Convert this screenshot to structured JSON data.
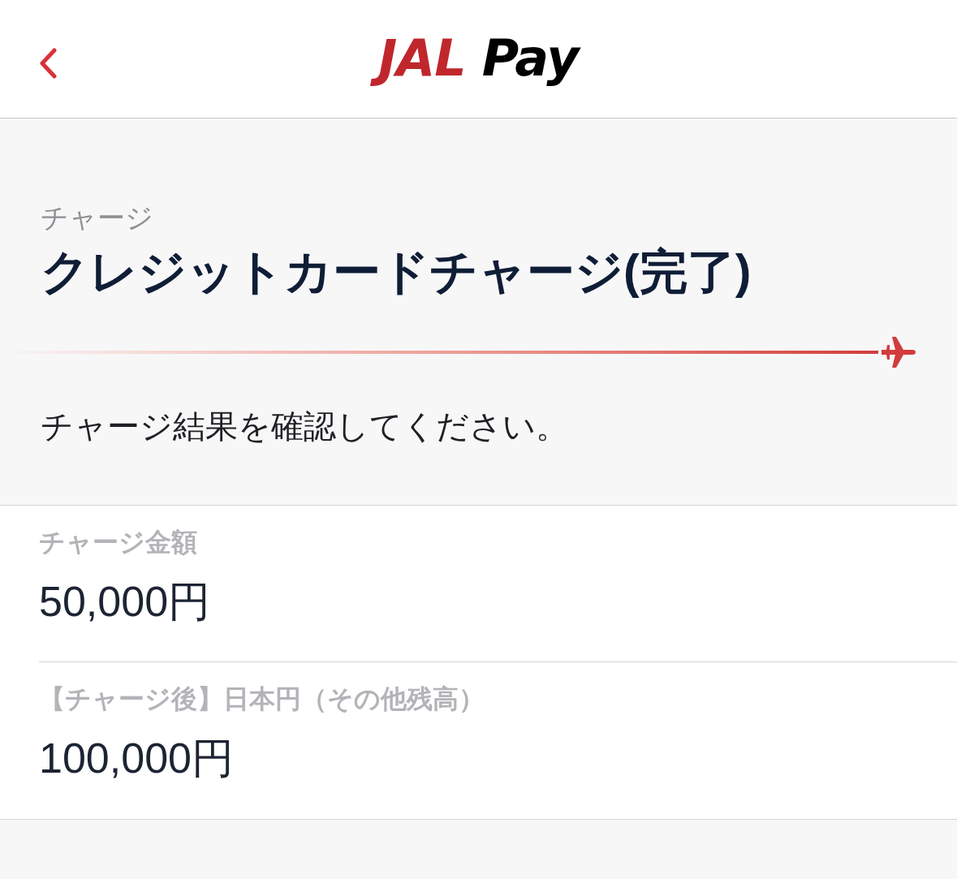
{
  "header": {
    "logo": {
      "brand": "JAL",
      "product": "Pay"
    }
  },
  "page": {
    "section": "チャージ",
    "title": "クレジットカードチャージ(完了)",
    "message": "チャージ結果を確認してください。"
  },
  "fields": [
    {
      "label": "チャージ金額",
      "value": "50,000円"
    },
    {
      "label": "【チャージ後】日本円（その他残高）",
      "value": "100,000円"
    }
  ]
}
